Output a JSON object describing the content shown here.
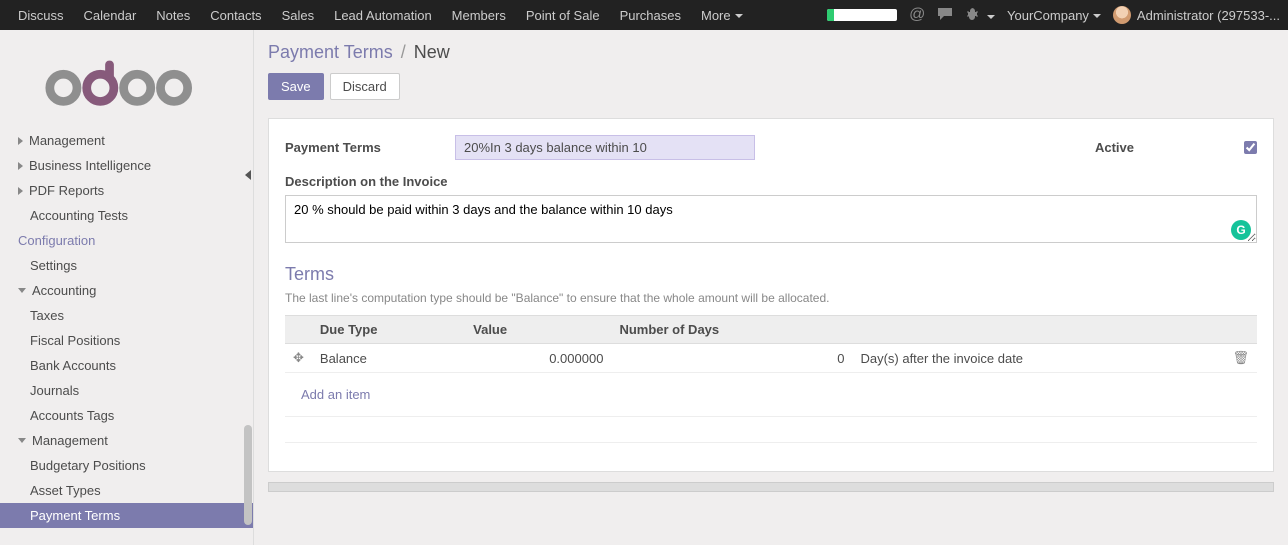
{
  "navbar": {
    "menus": [
      "Discuss",
      "Calendar",
      "Notes",
      "Contacts",
      "Sales",
      "Lead Automation",
      "Members",
      "Point of Sale",
      "Purchases"
    ],
    "more_label": "More",
    "company_label": "YourCompany",
    "user_label": "Administrator (297533-...",
    "icons": {
      "at": "@",
      "chat": "chat-icon",
      "bug": "bug-icon"
    }
  },
  "sidebar": {
    "items": [
      {
        "label": "Management",
        "level": 0,
        "expandable": true,
        "expanded": false
      },
      {
        "label": "Business Intelligence",
        "level": 0,
        "expandable": true,
        "expanded": false
      },
      {
        "label": "PDF Reports",
        "level": 0,
        "expandable": true,
        "expanded": false
      },
      {
        "label": "Accounting Tests",
        "level": 1,
        "expandable": false
      },
      {
        "label": "Configuration",
        "level": 0,
        "header": true
      },
      {
        "label": "Settings",
        "level": 1
      },
      {
        "label": "Accounting",
        "level": 0,
        "expandable": true,
        "expanded": true
      },
      {
        "label": "Taxes",
        "level": 2
      },
      {
        "label": "Fiscal Positions",
        "level": 2
      },
      {
        "label": "Bank Accounts",
        "level": 2
      },
      {
        "label": "Journals",
        "level": 2
      },
      {
        "label": "Accounts Tags",
        "level": 2
      },
      {
        "label": "Management",
        "level": 0,
        "expandable": true,
        "expanded": true
      },
      {
        "label": "Budgetary Positions",
        "level": 2
      },
      {
        "label": "Asset Types",
        "level": 2
      },
      {
        "label": "Payment Terms",
        "level": 2,
        "active": true
      }
    ]
  },
  "breadcrumb": {
    "root": "Payment Terms",
    "current": "New"
  },
  "buttons": {
    "save": "Save",
    "discard": "Discard"
  },
  "form": {
    "payment_terms_label": "Payment Terms",
    "payment_terms_value": "20%In 3 days balance within 10",
    "active_label": "Active",
    "active_value": true,
    "description_label": "Description on the Invoice",
    "description_value": "20 % should be paid within 3 days and the balance within 10 days"
  },
  "terms": {
    "title": "Terms",
    "help": "The last line's computation type should be \"Balance\" to ensure that the whole amount will be allocated.",
    "columns": {
      "due_type": "Due Type",
      "value": "Value",
      "num_days": "Number of Days"
    },
    "rows": [
      {
        "due_type": "Balance",
        "value": "0.000000",
        "num_days": "0",
        "option": "Day(s) after the invoice date"
      }
    ],
    "add_item_label": "Add an item"
  },
  "grammarly_badge": "G"
}
